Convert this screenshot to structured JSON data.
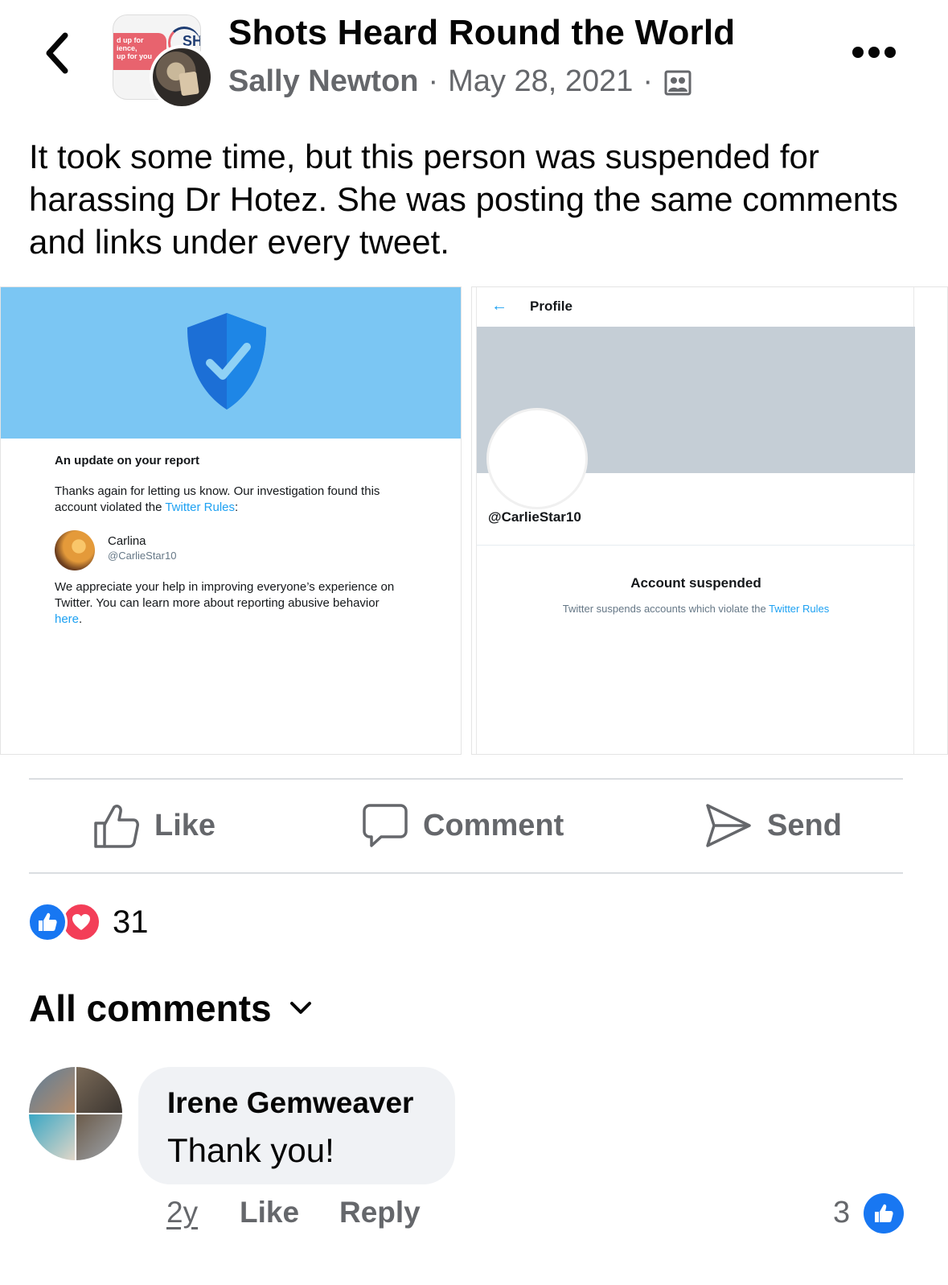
{
  "header": {
    "group_name": "Shots Heard Round the World",
    "author": "Sally Newton",
    "separator": "·",
    "date": "May 28, 2021",
    "privacy_icon": "group-members-icon",
    "group_avatar_text": [
      "d up for",
      "ience,",
      "up for you"
    ],
    "group_avatar_letters": "SH"
  },
  "post": {
    "text": "It took some time, but this person was suspended for harassing Dr Hotez. She was posting the same comments and links under every tweet."
  },
  "image_left": {
    "banner_color": "#7bc6f3",
    "title": "An update on your report",
    "body_prefix": "Thanks again for letting us know. Our investigation found this account violated the ",
    "body_link": "Twitter Rules",
    "body_suffix": ":",
    "user_name": "Carlina",
    "user_handle": "@CarlieStar10",
    "footer_prefix": "We appreciate your help in improving everyone’s experience on Twitter. You can learn more about reporting abusive behavior ",
    "footer_link": "here",
    "footer_suffix": "."
  },
  "image_right": {
    "back_arrow": "←",
    "title": "Profile",
    "handle": "@CarlieStar10",
    "status_title": "Account suspended",
    "status_prefix": "Twitter suspends accounts which violate the ",
    "status_link": "Twitter Rules"
  },
  "actions": {
    "like": "Like",
    "comment": "Comment",
    "send": "Send"
  },
  "reactions": {
    "count": "31",
    "types": [
      "like",
      "love"
    ]
  },
  "comments_header": {
    "label": "All comments"
  },
  "comment": {
    "author": "Irene Gemweaver",
    "text": "Thank you!",
    "time": "2y",
    "like": "Like",
    "reply": "Reply",
    "like_count": "3"
  },
  "colors": {
    "facebook_blue": "#1877f2",
    "love_red": "#f33e58",
    "secondary_text": "#65676b",
    "twitter_blue": "#1da1f2"
  }
}
